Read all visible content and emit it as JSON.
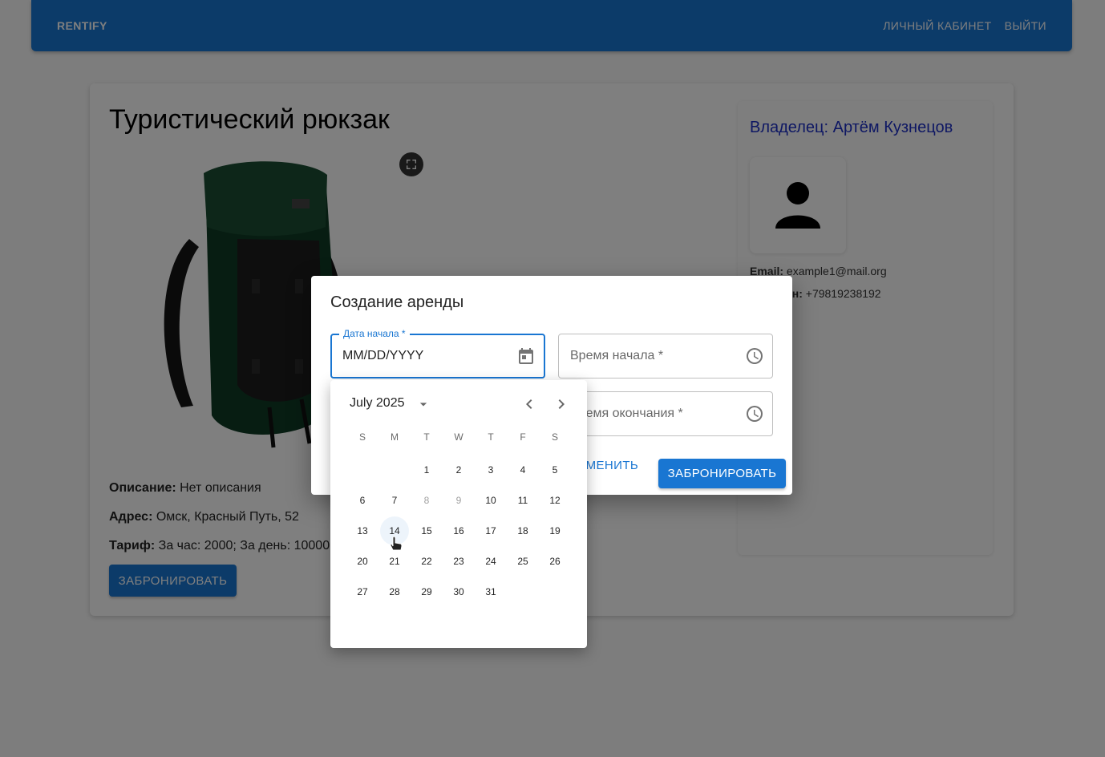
{
  "appbar": {
    "brand": "RENTIFY",
    "account": "ЛИЧНЫЙ КАБИНЕТ",
    "logout": "ВЫЙТИ"
  },
  "item": {
    "title": "Туристический рюкзак",
    "description_label": "Описание:",
    "description": "Нет описания",
    "address_label": "Адрес:",
    "address": "Омск, Красный Путь, 52",
    "tariff_label": "Тариф:",
    "tariff": "За час: 2000; За день: 10000",
    "book_label": "ЗАБРОНИРОВАТЬ"
  },
  "owner": {
    "title": "Владелец: Артём Кузнецов",
    "email_label": "Email:",
    "email": "example1@mail.org",
    "phone_label": "Телефон:",
    "phone": "+79819238192"
  },
  "dialog": {
    "title": "Создание аренды",
    "start_date_label": "Дата начала *",
    "start_date_placeholder": "MM/DD/YYYY",
    "start_time_label": "Время начала *",
    "end_time_label": "Время окончания *",
    "cancel": "ОТМЕНИТЬ",
    "confirm": "ЗАБРОНИРОВАТЬ"
  },
  "calendar": {
    "month_label": "July 2025",
    "weekdays": [
      "S",
      "M",
      "T",
      "W",
      "T",
      "F",
      "S"
    ],
    "weeks": [
      [
        "",
        "",
        "1",
        "2",
        "3",
        "4",
        "5"
      ],
      [
        "6",
        "7",
        "8",
        "9",
        "10",
        "11",
        "12"
      ],
      [
        "13",
        "14",
        "15",
        "16",
        "17",
        "18",
        "19"
      ],
      [
        "20",
        "21",
        "22",
        "23",
        "24",
        "25",
        "26"
      ],
      [
        "27",
        "28",
        "29",
        "30",
        "31",
        "",
        ""
      ]
    ],
    "disabled_days": [
      "8",
      "9"
    ],
    "hovered_day": "14"
  },
  "colors": {
    "primary": "#1976d2",
    "owner_title": "#1c2fc7"
  }
}
